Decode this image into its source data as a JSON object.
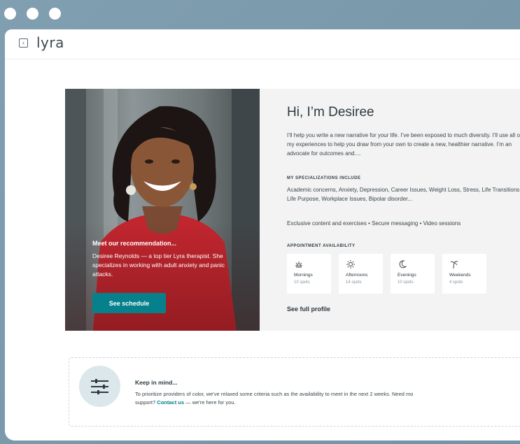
{
  "header": {
    "back_icon": "chevron-left-icon",
    "logo_text": "lyra"
  },
  "recommendation": {
    "title": "Meet our recommendation...",
    "text": "Desiree Reynolds  — a top tier Lyra therapist. She specializes in working with adult anxiety and panic attacks.",
    "button_label": "See schedule"
  },
  "profile": {
    "greeting": "Hi, I’m Desiree",
    "bio": "I’ll help you write a new narrative for your life. I’ve been exposed to much diversity. I’ll use all of my experiences to help you draw from your own to create a new, healthier narrative. I’m an advocate for outcomes and....",
    "specializations_label": "MY SPECIALIZATIONS INCLUDE",
    "specializations": "Academic concerns, Anxiety, Depression, Career Issues, Weight Loss, Stress, Life Transitions, Life Purpose, Workplace Issues, Bipolar disorder...",
    "features": "Exclusive content and exercises  •  Secure messaging  •  Video sessions",
    "availability_label": "APPOINTMENT AVAILABILITY",
    "availability": [
      {
        "icon": "sunrise-icon",
        "label": "Mornings",
        "spots": "10 spots"
      },
      {
        "icon": "sun-icon",
        "label": "Afternoons",
        "spots": "14 spots"
      },
      {
        "icon": "moon-icon",
        "label": "Evenings",
        "spots": "10 spots"
      },
      {
        "icon": "palm-tree-icon",
        "label": "Weekends",
        "spots": "4 spots"
      }
    ],
    "full_profile_link": "See full profile"
  },
  "keep_in_mind": {
    "icon": "sliders-icon",
    "title": "Keep in mind...",
    "text_before": "To prioritize providers of color, we've relaxed some criteria such as the availability to meet in the next 2 weeks. Need mo",
    "text_line2": "support? ",
    "link": "Contact us",
    "text_after": "  — we're here for you."
  },
  "colors": {
    "accent": "#06818c",
    "frame": "#7a9aab",
    "card_bg": "#f3f3f3",
    "text_dark": "#2d3940"
  }
}
